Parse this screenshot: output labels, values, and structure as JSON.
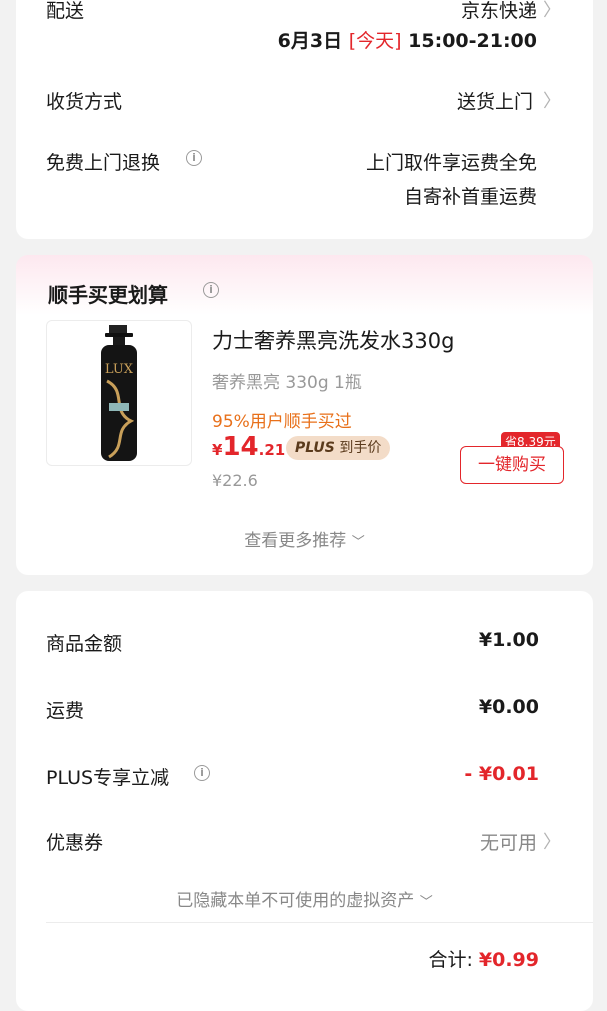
{
  "delivery": {
    "label": "配送",
    "carrier": "京东快递",
    "date": "6月3日",
    "today_tag": "[今天]",
    "time": "15:00-21:00"
  },
  "receipt": {
    "label": "收货方式",
    "value": "送货上门"
  },
  "returns": {
    "label": "免费上门退换",
    "line1": "上门取件享运费全免",
    "line2": "自寄补首重运费"
  },
  "recommend": {
    "title": "顺手买更划算",
    "product": {
      "name": "力士奢养黑亮洗发水330g",
      "spec": "奢养黑亮 330g 1瓶",
      "promo": "95%用户顺手买过",
      "price_symbol": "¥",
      "price_int": "14",
      "price_dec": ".21",
      "plus_label": "PLUS",
      "plus_suffix": "到手价",
      "original_price": "¥22.6",
      "save_badge": "省8.39元",
      "buy_button": "一键购买",
      "brand_logo": "LUX"
    },
    "more_label": "查看更多推荐"
  },
  "summary": {
    "goods_label": "商品金额",
    "goods_value": "¥1.00",
    "shipping_label": "运费",
    "shipping_value": "¥0.00",
    "plus_label": "PLUS专享立减",
    "plus_value": "- ¥0.01",
    "coupon_label": "优惠券",
    "coupon_value": "无可用",
    "hidden_assets": "已隐藏本单不可使用的虚拟资产",
    "total_label": "合计:",
    "total_value": "¥0.99"
  },
  "colors": {
    "accent": "#e3262b",
    "promo": "#e8701a",
    "plus_bg": "#f3dcc8",
    "plus_text": "#5a3a1c"
  }
}
